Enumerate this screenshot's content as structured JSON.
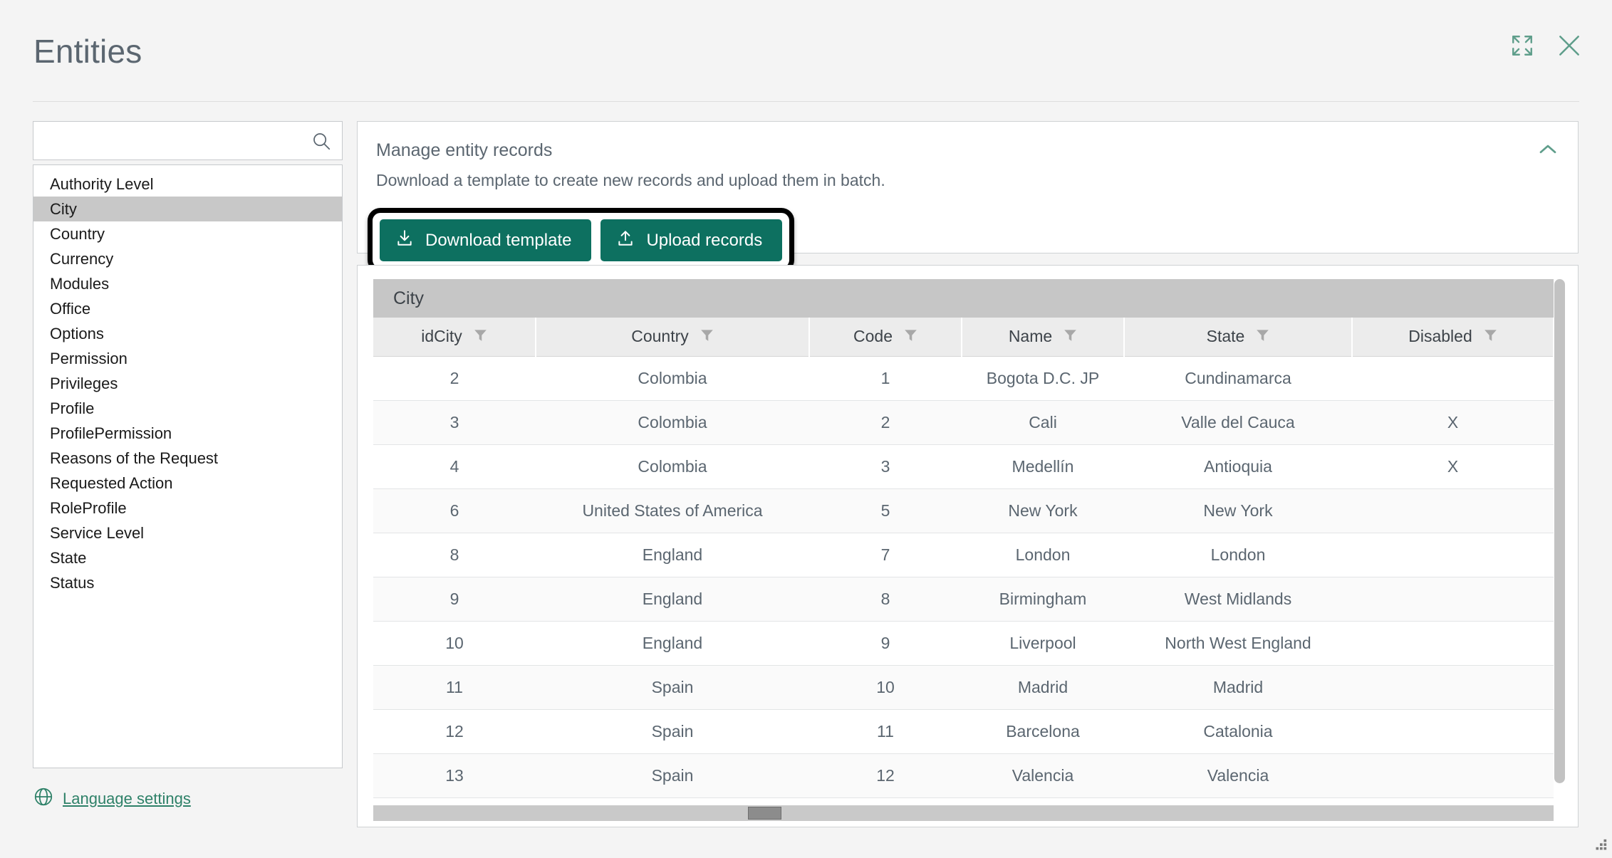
{
  "header": {
    "title": "Entities",
    "expand_icon": "expand-icon",
    "close_icon": "close-icon"
  },
  "sidebar": {
    "search": {
      "value": "",
      "placeholder": ""
    },
    "search_icon": "search-icon",
    "items": [
      {
        "label": "Authority Level",
        "selected": false
      },
      {
        "label": "City",
        "selected": true
      },
      {
        "label": "Country",
        "selected": false
      },
      {
        "label": "Currency",
        "selected": false
      },
      {
        "label": "Modules",
        "selected": false
      },
      {
        "label": "Office",
        "selected": false
      },
      {
        "label": "Options",
        "selected": false
      },
      {
        "label": "Permission",
        "selected": false
      },
      {
        "label": "Privileges",
        "selected": false
      },
      {
        "label": "Profile",
        "selected": false
      },
      {
        "label": "ProfilePermission",
        "selected": false
      },
      {
        "label": "Reasons of the Request",
        "selected": false
      },
      {
        "label": "Requested Action",
        "selected": false
      },
      {
        "label": "RoleProfile",
        "selected": false
      },
      {
        "label": "Service Level",
        "selected": false
      },
      {
        "label": "State",
        "selected": false
      },
      {
        "label": "Status",
        "selected": false
      }
    ],
    "language_settings": {
      "label": "Language settings",
      "icon": "globe-icon"
    }
  },
  "manage_panel": {
    "title": "Manage entity records",
    "description": "Download a template to create new records and upload them in batch.",
    "collapse_icon": "chevron-up-icon",
    "buttons": [
      {
        "label": "Download template",
        "icon": "download-icon"
      },
      {
        "label": "Upload records",
        "icon": "upload-icon"
      }
    ]
  },
  "table": {
    "caption": "City",
    "filter_icon": "filter-icon",
    "columns": [
      "idCity",
      "Country",
      "Code",
      "Name",
      "State",
      "Disabled"
    ],
    "rows": [
      [
        "2",
        "Colombia",
        "1",
        "Bogota D.C. JP",
        "Cundinamarca",
        ""
      ],
      [
        "3",
        "Colombia",
        "2",
        "Cali",
        "Valle del Cauca",
        "X"
      ],
      [
        "4",
        "Colombia",
        "3",
        "Medellín",
        "Antioquia",
        "X"
      ],
      [
        "6",
        "United States of America",
        "5",
        "New York",
        "New York",
        ""
      ],
      [
        "8",
        "England",
        "7",
        "London",
        "London",
        ""
      ],
      [
        "9",
        "England",
        "8",
        "Birmingham",
        "West Midlands",
        ""
      ],
      [
        "10",
        "England",
        "9",
        "Liverpool",
        "North West England",
        ""
      ],
      [
        "11",
        "Spain",
        "10",
        "Madrid",
        "Madrid",
        ""
      ],
      [
        "12",
        "Spain",
        "11",
        "Barcelona",
        "Catalonia",
        ""
      ],
      [
        "13",
        "Spain",
        "12",
        "Valencia",
        "Valencia",
        ""
      ]
    ]
  },
  "colors": {
    "accent": "#0d7060",
    "link": "#2e8168",
    "title": "#5b6670",
    "highlight": "#000000",
    "selected_row": "#c8c8c8"
  }
}
